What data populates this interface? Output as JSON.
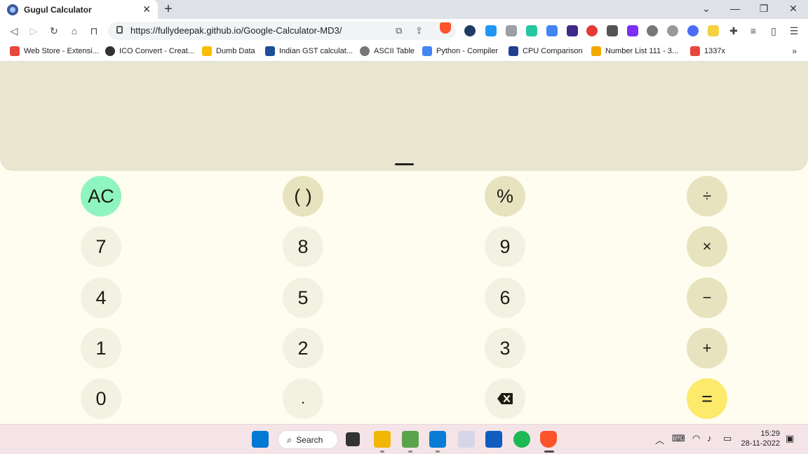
{
  "browser": {
    "tab_title": "Gugul Calculator",
    "tab_close": "✕",
    "new_tab": "+",
    "url": "https://fullydeepak.github.io/Google-Calculator-MD3/",
    "window_controls": [
      "⌄",
      "—",
      "❐",
      "✕"
    ]
  },
  "bookmarks": [
    {
      "label": "Web Store - Extensi...",
      "color": "#e8453c"
    },
    {
      "label": "ICO Convert - Creat...",
      "color": "#333333"
    },
    {
      "label": "Dumb Data",
      "color": "#1a73e8"
    },
    {
      "label": "Indian GST calculat...",
      "color": "#1f4e99"
    },
    {
      "label": "ASCII Table",
      "color": "#555555"
    },
    {
      "label": "Python - Compiler",
      "color": "#4285f4"
    },
    {
      "label": "CPU Comparison",
      "color": "#1f3f8f"
    },
    {
      "label": "Number List 111 - 3...",
      "color": "#f2a900"
    },
    {
      "label": "1337x",
      "color": "#e8453c"
    }
  ],
  "bookmarks_more": "»",
  "calculator": {
    "display_value": "",
    "keys": {
      "ac": "AC",
      "parens": "( )",
      "percent": "%",
      "divide": "÷",
      "seven": "7",
      "eight": "8",
      "nine": "9",
      "multiply": "×",
      "four": "4",
      "five": "5",
      "six": "6",
      "minus": "−",
      "one": "1",
      "two": "2",
      "three": "3",
      "plus": "+",
      "zero": "0",
      "decimal": ".",
      "backspace": "⌫",
      "equals": "="
    },
    "colors": {
      "display_bg": "#e8e6cf",
      "page_bg": "#fefdf0",
      "number_key": "#f3f1e2",
      "function_key": "#e8e3bf",
      "ac_key": "#8ff5c0",
      "equals_key": "#fde96a"
    }
  },
  "taskbar": {
    "search_label": "Search",
    "time": "15:29",
    "date": "28-11-2022"
  }
}
